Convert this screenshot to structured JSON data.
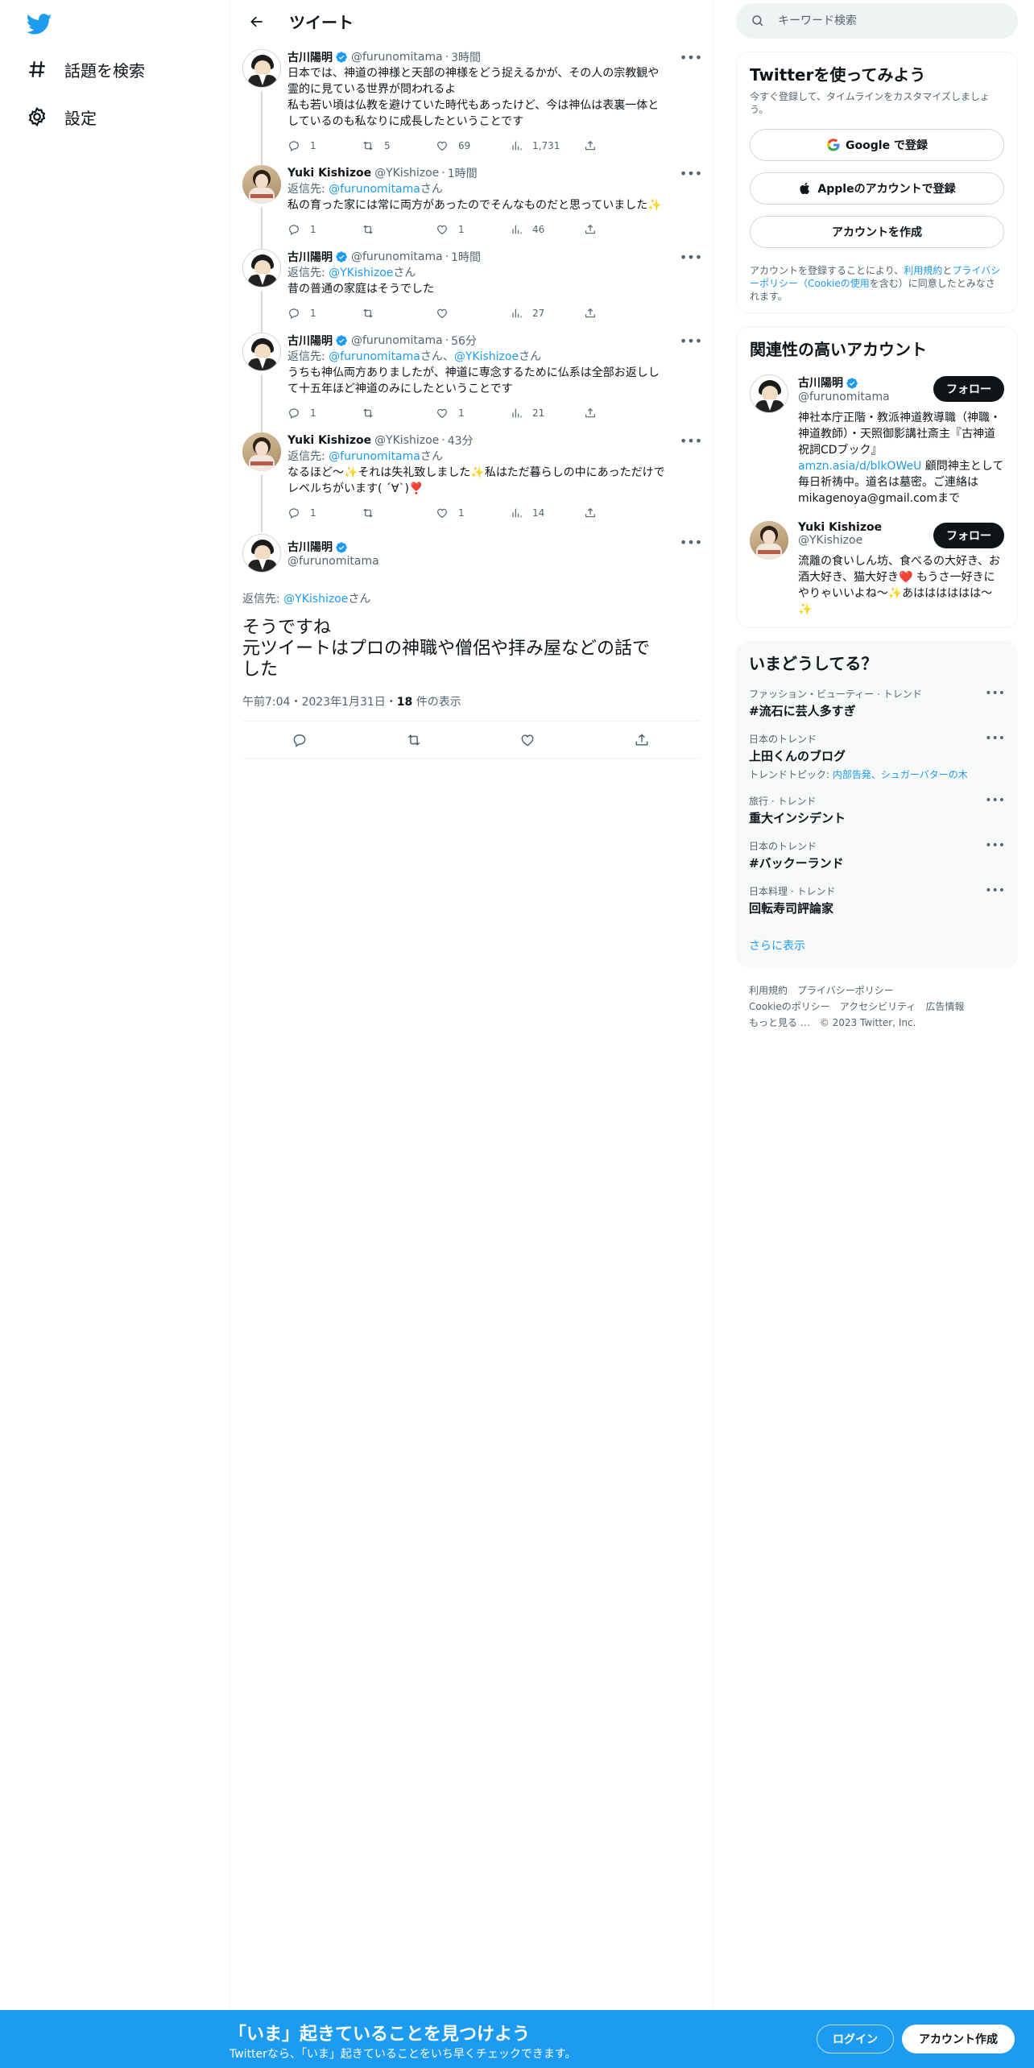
{
  "nav": {
    "explore": "話題を検索",
    "settings": "設定"
  },
  "main": {
    "title": "ツイート"
  },
  "tweets": [
    {
      "name": "古川陽明",
      "handle": "@furunomitama",
      "time": "3時間",
      "verified": true,
      "reply_prefix": "",
      "reply_to": "",
      "reply_suffix": "",
      "reply_to2": "",
      "reply_suffix2": "",
      "text": "日本では、神道の神様と天部の神様をどう捉えるかが、その人の宗教観や\n霊的に見ている世界が問われるよ\n私も若い頃は仏教を避けていた時代もあったけど、今は神仏は表裏一体と\nしているのも私なりに成長したということです",
      "replies": "1",
      "retweets": "5",
      "likes": "69",
      "views": "1,731"
    },
    {
      "name": "Yuki Kishizoe",
      "handle": "@YKishizoe",
      "time": "1時間",
      "verified": false,
      "reply_prefix": "返信先: ",
      "reply_to": "@furunomitama",
      "reply_suffix": "さん",
      "reply_to2": "",
      "reply_suffix2": "",
      "text": "私の育った家には常に両方があったのでそんなものだと思っていました✨",
      "replies": "1",
      "retweets": "",
      "likes": "1",
      "views": "46"
    },
    {
      "name": "古川陽明",
      "handle": "@furunomitama",
      "time": "1時間",
      "verified": true,
      "reply_prefix": "返信先: ",
      "reply_to": "@YKishizoe",
      "reply_suffix": "さん",
      "reply_to2": "",
      "reply_suffix2": "",
      "text": "昔の普通の家庭はそうでした",
      "replies": "1",
      "retweets": "",
      "likes": "",
      "views": "27"
    },
    {
      "name": "古川陽明",
      "handle": "@furunomitama",
      "time": "56分",
      "verified": true,
      "reply_prefix": "返信先: ",
      "reply_to": "@furunomitama",
      "reply_suffix": "さん、",
      "reply_to2": "@YKishizoe",
      "reply_suffix2": "さん",
      "text": "うちも神仏両方ありましたが、神道に専念するために仏系は全部お返しし\nて十五年ほど神道のみにしたということです",
      "replies": "1",
      "retweets": "",
      "likes": "1",
      "views": "21"
    },
    {
      "name": "Yuki Kishizoe",
      "handle": "@YKishizoe",
      "time": "43分",
      "verified": false,
      "reply_prefix": "返信先: ",
      "reply_to": "@furunomitama",
      "reply_suffix": "さん",
      "reply_to2": "",
      "reply_suffix2": "",
      "text": "なるほど～✨それは失礼致しました✨私はただ暮らしの中にあっただけで\nレベルちがいます( ´∀`)❣️",
      "replies": "1",
      "retweets": "",
      "likes": "1",
      "views": "14"
    }
  ],
  "focus_tweet": {
    "name": "古川陽明",
    "handle": "@furunomitama",
    "reply_prefix": "返信先: ",
    "reply_to": "@YKishizoe",
    "reply_suffix": "さん",
    "text": "そうですね\n元ツイートはプロの神職や僧侶や拝み屋などの話で\nした",
    "timestamp": "午前7:04・2023年1月31日・",
    "views_count": "18",
    "views_label": " 件の表示"
  },
  "search": {
    "placeholder": "キーワード検索"
  },
  "signup_card": {
    "title": "Twitterを使ってみよう",
    "subtitle": "今すぐ登録して、タイムラインをカスタマイズしましょう。",
    "google_label": "Google で登録",
    "apple_label": "Appleのアカウントで登録",
    "create_label": "アカウントを作成",
    "terms_prefix": "アカウントを登録することにより、",
    "terms_link1": "利用規約",
    "terms_and": "と",
    "terms_link2": "プライバシーポリシー（Cookieの使用",
    "terms_suffix": "を含む）に同意したとみなされます。"
  },
  "related": {
    "title": "関連性の高いアカウント",
    "follow_label": "フォロー",
    "accounts": [
      {
        "name": "古川陽明",
        "handle": "@furunomitama",
        "bio_before": "神社本庁正階・教派神道教導職（神職・神道教師）・天照御影講社斎主『古神道祝詞CDブック』",
        "bio_link": "amzn.asia/d/blkOWeU",
        "bio_after": " 顧問神主として毎日祈祷中。道名は墓密。ご連絡はmikagenoya@gmail.comまで"
      },
      {
        "name": "Yuki Kishizoe",
        "handle": "@YKishizoe",
        "bio_before": "流離の食いしん坊、食べるの大好き、お酒大好き、猫大好き❤️ もうさ一好きにやりゃいいよね～✨あはははははは～✨",
        "bio_link": "",
        "bio_after": ""
      }
    ]
  },
  "trends": {
    "title": "いまどうしてる？",
    "items": [
      {
        "category": "ファッション・ビューティー · トレンド",
        "name": "#流石に芸人多すぎ",
        "topics_label": "",
        "topics": ""
      },
      {
        "category": "日本のトレンド",
        "name": "上田くんのブログ",
        "topics_label": "トレンドトピック: ",
        "topics": "内部告発、シュガーバターの木"
      },
      {
        "category": "旅行 · トレンド",
        "name": "重大インシデント",
        "topics_label": "",
        "topics": ""
      },
      {
        "category": "日本のトレンド",
        "name": "#バックーランド",
        "topics_label": "",
        "topics": ""
      },
      {
        "category": "日本料理 · トレンド",
        "name": "回転寿司評論家",
        "topics_label": "",
        "topics": ""
      }
    ],
    "show_more": "さらに表示"
  },
  "footer": {
    "terms": "利用規約",
    "privacy": "プライバシーポリシー",
    "cookie": "Cookieのポリシー",
    "accessibility": "アクセシビリティ",
    "ads": "広告情報",
    "more": "もっと見る …",
    "copyright": "© 2023 Twitter, Inc."
  },
  "bottom_bar": {
    "title": "「いま」起きていることを見つけよう",
    "subtitle": "Twitterなら、「いま」起きていることをいち早くチェックできます。",
    "login": "ログイン",
    "signup": "アカウント作成"
  },
  "colors": {
    "accent": "#1d9bf0",
    "text": "#0f1419",
    "muted": "#536471",
    "border": "#eff3f4"
  }
}
